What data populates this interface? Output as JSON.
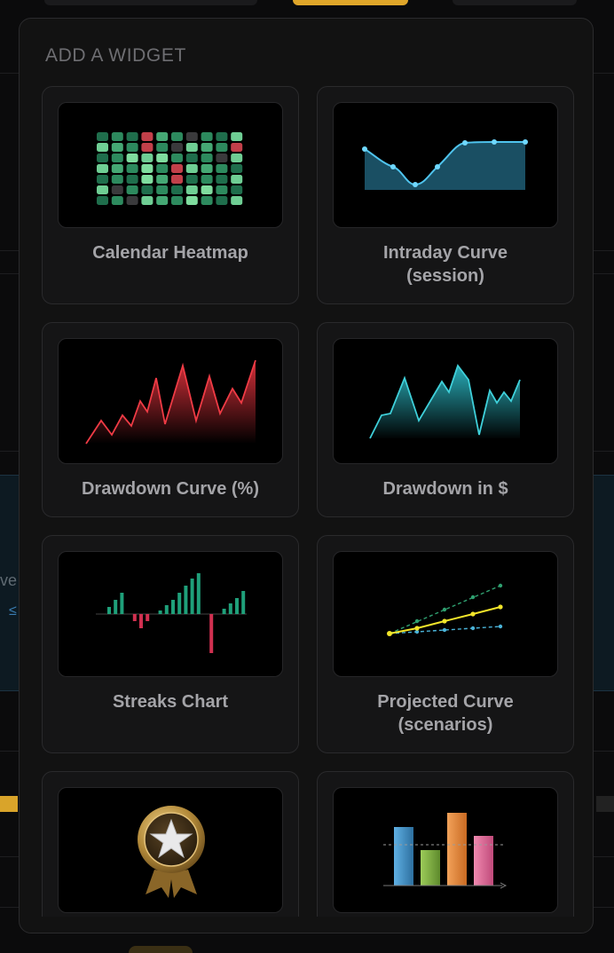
{
  "modal": {
    "title": "ADD A WIDGET"
  },
  "background": {
    "partial_text": "ve",
    "partial_link": "≤"
  },
  "widgets": [
    {
      "label": "Calendar Heatmap",
      "icon": "calendar-heatmap-icon"
    },
    {
      "label": "Intraday Curve\n(session)",
      "icon": "intraday-curve-icon"
    },
    {
      "label": "Drawdown Curve (%)",
      "icon": "drawdown-percent-icon"
    },
    {
      "label": "Drawdown in $",
      "icon": "drawdown-dollar-icon"
    },
    {
      "label": "Streaks Chart",
      "icon": "streaks-chart-icon"
    },
    {
      "label": "Projected Curve\n(scenarios)",
      "icon": "projected-curve-icon"
    },
    {
      "label": "",
      "icon": "medal-icon"
    },
    {
      "label": "",
      "icon": "bar-comparison-icon"
    }
  ],
  "colors": {
    "heat_green": "#3fae7a",
    "heat_red": "#c2404a",
    "curve_blue": "#4fb8e0",
    "drawdown_red": "#e0323c",
    "drawdown_teal": "#2bb8c4",
    "streak_green": "#1fa07a",
    "streak_red": "#d03050",
    "projection_yellow": "#f2e52a"
  }
}
